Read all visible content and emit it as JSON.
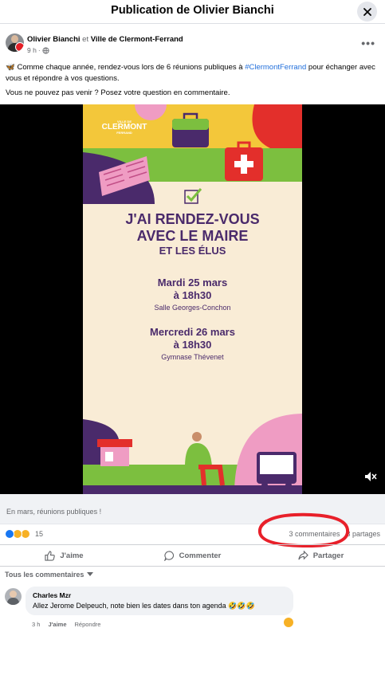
{
  "header": {
    "title": "Publication de Olivier Bianchi"
  },
  "post": {
    "author": "Olivier Bianchi",
    "and": "et",
    "coauthor": "Ville de Clermont-Ferrand",
    "time": "9 h",
    "text_intro": "🦋 Comme chaque année, rendez-vous lors de 6 réunions publiques à ",
    "hashtag": "#ClermontFerrand",
    "text_after": " pour échanger avec vous et répondre à vos questions.",
    "text_line2": "Vous ne pouvez pas venir ? Posez votre question en commentaire."
  },
  "poster": {
    "logo_small": "VILLE DE",
    "logo": "CLERMONT",
    "logo_sub": "FERRAND",
    "headline1": "J'AI RENDEZ-VOUS",
    "headline2": "AVEC LE MAIRE",
    "headline3": "ET LES ÉLUS",
    "date1": "Mardi 25 mars",
    "time1": "à 18h30",
    "place1": "Salle Georges-Conchon",
    "date2": "Mercredi 26 mars",
    "time2": "à 18h30",
    "place2": "Gymnase Thévenet"
  },
  "caption": "En mars, réunions publiques !",
  "stats": {
    "reaction_count": "15",
    "comments": "3 commentaires",
    "shares": "3 partages"
  },
  "actions": {
    "like": "J'aime",
    "comment": "Commenter",
    "share": "Partager"
  },
  "comments_filter": "Tous les commentaires",
  "comment": {
    "name": "Charles Mzr",
    "text": "Allez Jerome Delpeuch, note bien les dates dans ton agenda 🤣🤣🤣",
    "time": "3 h",
    "like": "J'aime",
    "reply": "Répondre"
  },
  "colors": {
    "facebook_blue": "#1877f2",
    "poster_purple": "#4a2a6b",
    "poster_green": "#7cbf3f",
    "annotation_red": "#e8202a"
  }
}
